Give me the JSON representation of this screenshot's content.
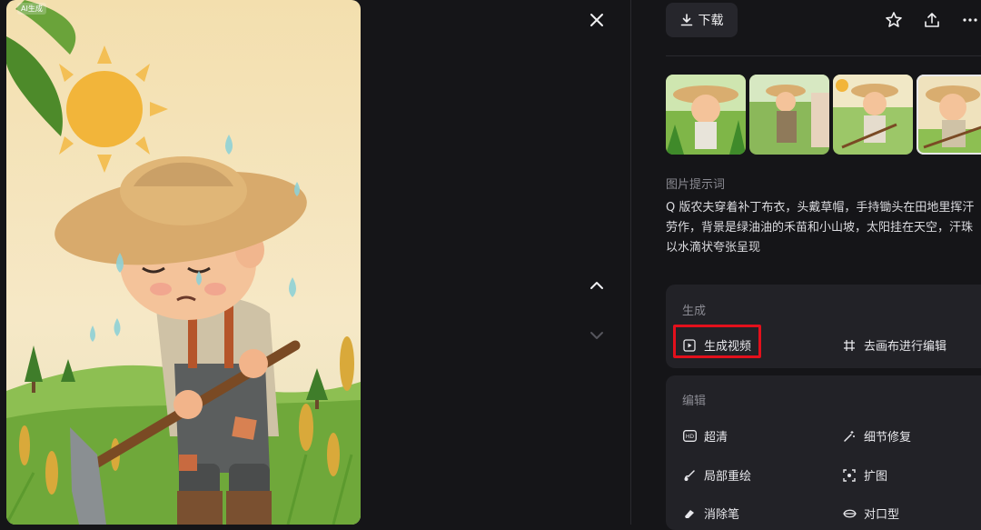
{
  "image": {
    "ai_tag": "AI生成",
    "alt": "Q版农夫"
  },
  "toolbar": {
    "download_label": "下载",
    "icons": [
      "star-icon",
      "share-icon",
      "more-icon"
    ]
  },
  "thumbnails": [
    {
      "name": "thumbnail-1",
      "selected": false
    },
    {
      "name": "thumbnail-2",
      "selected": false
    },
    {
      "name": "thumbnail-3",
      "selected": false
    },
    {
      "name": "thumbnail-4",
      "selected": true
    }
  ],
  "prompt": {
    "label": "图片提示词",
    "text": "Q 版农夫穿着补丁布衣，头戴草帽，手持锄头在田地里挥汗\n劳作，背景是绿油油的禾苗和小山坡，太阳挂在天空，汗珠\n以水滴状夸张呈现"
  },
  "generate": {
    "title": "生成",
    "actions": [
      {
        "label": "生成视频",
        "icon": "play-video-icon"
      },
      {
        "label": "去画布进行编辑",
        "icon": "canvas-edit-icon"
      }
    ]
  },
  "edit": {
    "title": "编辑",
    "actions": [
      {
        "label": "超清",
        "icon": "hd-icon"
      },
      {
        "label": "细节修复",
        "icon": "magic-wand-icon"
      },
      {
        "label": "局部重绘",
        "icon": "brush-icon"
      },
      {
        "label": "扩图",
        "icon": "expand-icon"
      },
      {
        "label": "消除笔",
        "icon": "eraser-icon"
      },
      {
        "label": "对口型",
        "icon": "lips-icon"
      }
    ]
  },
  "colors": {
    "background": "#151518",
    "card": "#222227",
    "highlight": "#e3101c"
  }
}
